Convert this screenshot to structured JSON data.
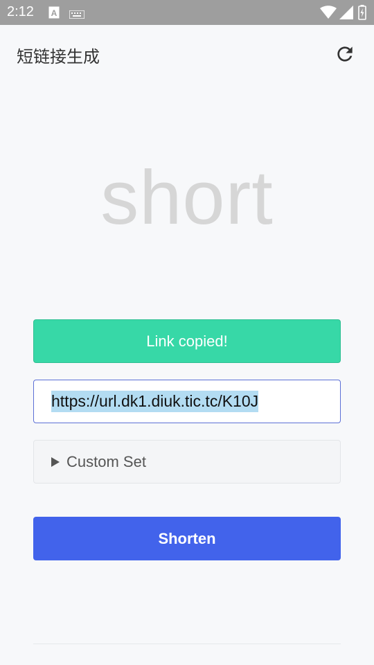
{
  "status_bar": {
    "time": "2:12",
    "icons": [
      "text-a-icon",
      "keyboard-icon",
      "wifi-icon",
      "cell-signal-icon",
      "battery-icon"
    ]
  },
  "app_bar": {
    "title": "短链接生成",
    "refresh_icon": "refresh-icon"
  },
  "logo": {
    "text": "short"
  },
  "toast": {
    "message": "Link copied!",
    "color": "#37d8a7"
  },
  "url_field": {
    "value": "https://url.dk1.diuk.tic.tc/K10J",
    "selected": true
  },
  "custom_set": {
    "label": "Custom Set",
    "icon": "triangle-right-icon",
    "expanded": false
  },
  "shorten_button": {
    "label": "Shorten",
    "color": "#4263eb"
  }
}
